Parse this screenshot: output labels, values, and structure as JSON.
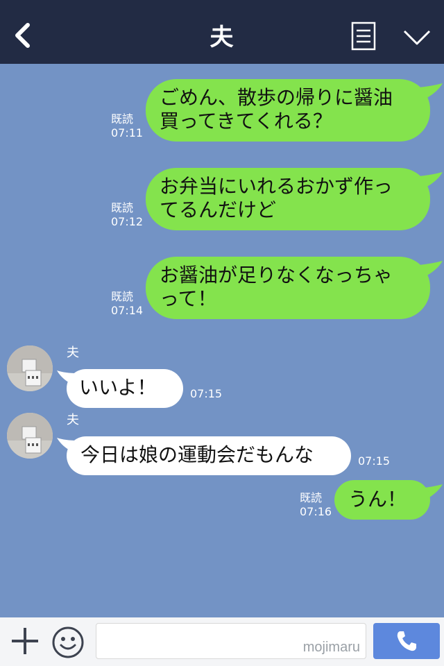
{
  "header": {
    "title": "夫",
    "icons": {
      "back": "chevron-left-icon",
      "menu": "menu-icon",
      "expand": "chevron-down-icon"
    }
  },
  "messages": [
    {
      "dir": "out",
      "lines": [
        "ごめん、散歩の帰りに醤油",
        "買ってきてくれる？"
      ],
      "read": "既読",
      "time": "07:11"
    },
    {
      "dir": "out",
      "lines": [
        "お弁当にいれるおかず作っ",
        "てるんだけど"
      ],
      "read": "既読",
      "time": "07:12"
    },
    {
      "dir": "out",
      "lines": [
        "お醤油が足りなくなっちゃ",
        "って！"
      ],
      "read": "既読",
      "time": "07:14"
    },
    {
      "dir": "in",
      "sender": "夫",
      "lines": [
        "いいよ！"
      ],
      "time": "07:15"
    },
    {
      "dir": "in",
      "sender": "夫",
      "lines": [
        "今日は娘の運動会だもんな"
      ],
      "time": "07:15"
    },
    {
      "dir": "out",
      "lines": [
        "うん！"
      ],
      "read": "既読",
      "time": "07:16"
    }
  ],
  "footer": {
    "input_value": "",
    "watermark": "mojimaru",
    "icons": {
      "plus": "plus-icon",
      "emoji": "smile-icon",
      "call": "phone-icon"
    }
  },
  "colors": {
    "header_bg": "#222b44",
    "chat_bg": "#7393c5",
    "outgoing_bubble": "#84e34d",
    "incoming_bubble": "#ffffff",
    "call_button": "#5d88dd"
  }
}
